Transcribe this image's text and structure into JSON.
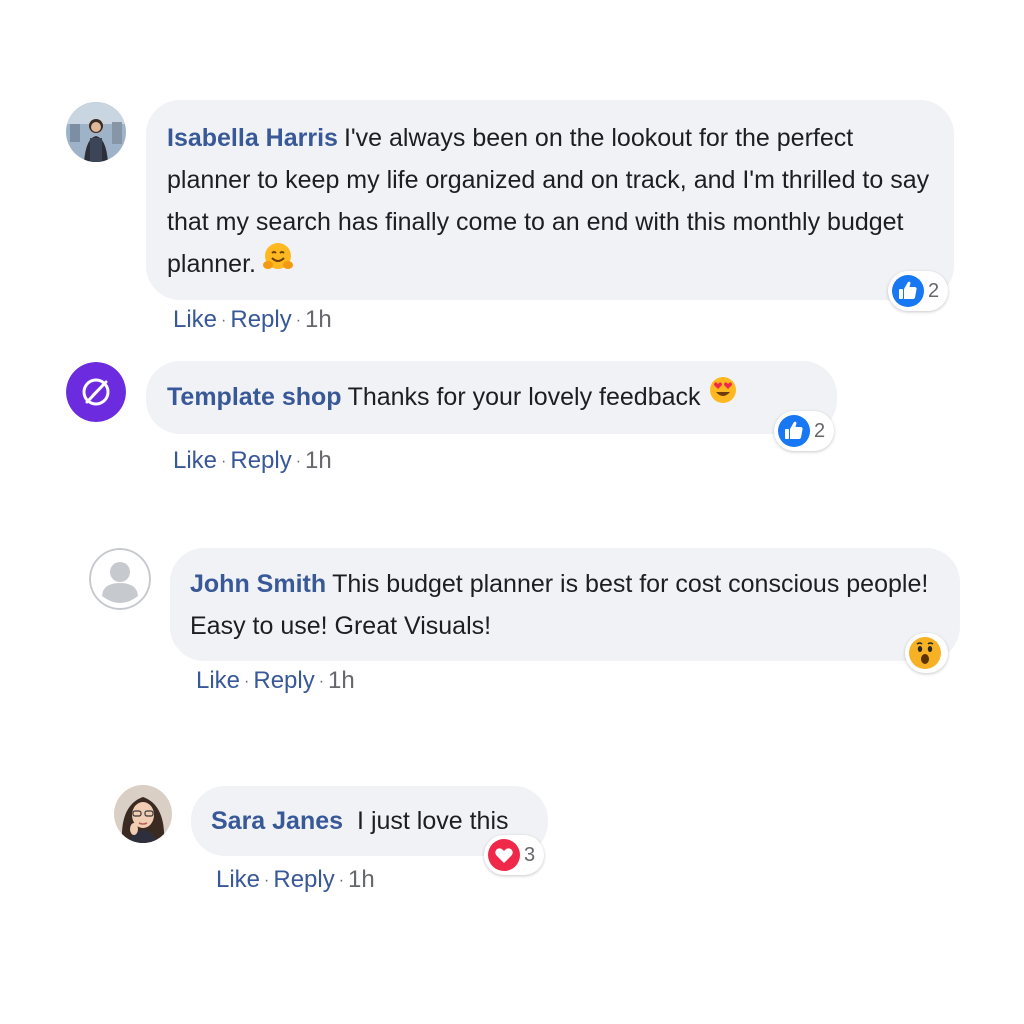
{
  "comments": [
    {
      "author": "Isabella Harris",
      "text": "I've always been on the lookout for the perfect planner to keep my life organized and on track, and I'm thrilled to say that my search has finally come to an end with this monthly budget planner.",
      "emoji": "hugging-face",
      "reaction": {
        "type": "like",
        "count": "2"
      },
      "actions": {
        "like": "Like",
        "reply": "Reply",
        "time": "1h"
      }
    },
    {
      "author": "Template shop",
      "text": "Thanks for your lovely feedback",
      "emoji": "heart-eyes",
      "reaction": {
        "type": "like",
        "count": "2"
      },
      "actions": {
        "like": "Like",
        "reply": "Reply",
        "time": "1h"
      }
    },
    {
      "author": "John Smith",
      "text": "This budget planner is best for cost conscious people! Easy to use! Great Visuals!",
      "reaction": {
        "type": "wow",
        "count": ""
      },
      "actions": {
        "like": "Like",
        "reply": "Reply",
        "time": "1h"
      }
    },
    {
      "author": "Sara Janes",
      "text": "I just love this",
      "reaction": {
        "type": "love",
        "count": "3"
      },
      "actions": {
        "like": "Like",
        "reply": "Reply",
        "time": "1h"
      }
    }
  ],
  "colors": {
    "bubble": "#f0f2f5",
    "author": "#385898",
    "like_blue": "#1877f2",
    "love_red": "#f02849",
    "wow_yellow": "#f7b125",
    "shop_avatar": "#6d2be0"
  }
}
